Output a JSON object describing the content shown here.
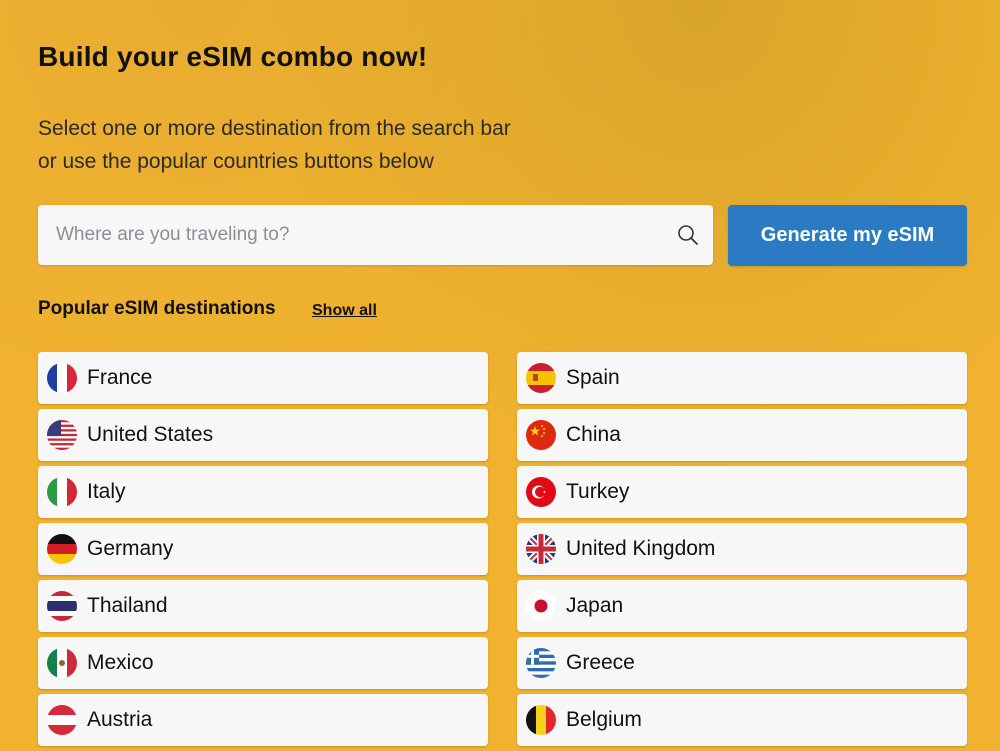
{
  "header": {
    "title": "Build your eSIM combo now!",
    "subtitle_line1": "Select one or more destination from the search bar",
    "subtitle_line2": "or use the popular countries buttons below"
  },
  "search": {
    "placeholder": "Where are you traveling to?",
    "value": "",
    "icon": "search-icon"
  },
  "generate_button": {
    "label": "Generate my eSIM",
    "color": "#2b7bc2"
  },
  "popular": {
    "heading": "Popular eSIM destinations",
    "show_all": "Show all",
    "left": [
      {
        "name": "France",
        "flag": "flag-france-icon"
      },
      {
        "name": "United States",
        "flag": "flag-united-states-icon"
      },
      {
        "name": "Italy",
        "flag": "flag-italy-icon"
      },
      {
        "name": "Germany",
        "flag": "flag-germany-icon"
      },
      {
        "name": "Thailand",
        "flag": "flag-thailand-icon"
      },
      {
        "name": "Mexico",
        "flag": "flag-mexico-icon"
      },
      {
        "name": "Austria",
        "flag": "flag-austria-icon"
      }
    ],
    "right": [
      {
        "name": "Spain",
        "flag": "flag-spain-icon"
      },
      {
        "name": "China",
        "flag": "flag-china-icon"
      },
      {
        "name": "Turkey",
        "flag": "flag-turkey-icon"
      },
      {
        "name": "United Kingdom",
        "flag": "flag-united-kingdom-icon"
      },
      {
        "name": "Japan",
        "flag": "flag-japan-icon"
      },
      {
        "name": "Greece",
        "flag": "flag-greece-icon"
      },
      {
        "name": "Belgium",
        "flag": "flag-belgium-icon"
      }
    ]
  },
  "colors": {
    "background": "#f0b22f",
    "card": "#f7f7f7",
    "accent": "#2b7bc2"
  }
}
